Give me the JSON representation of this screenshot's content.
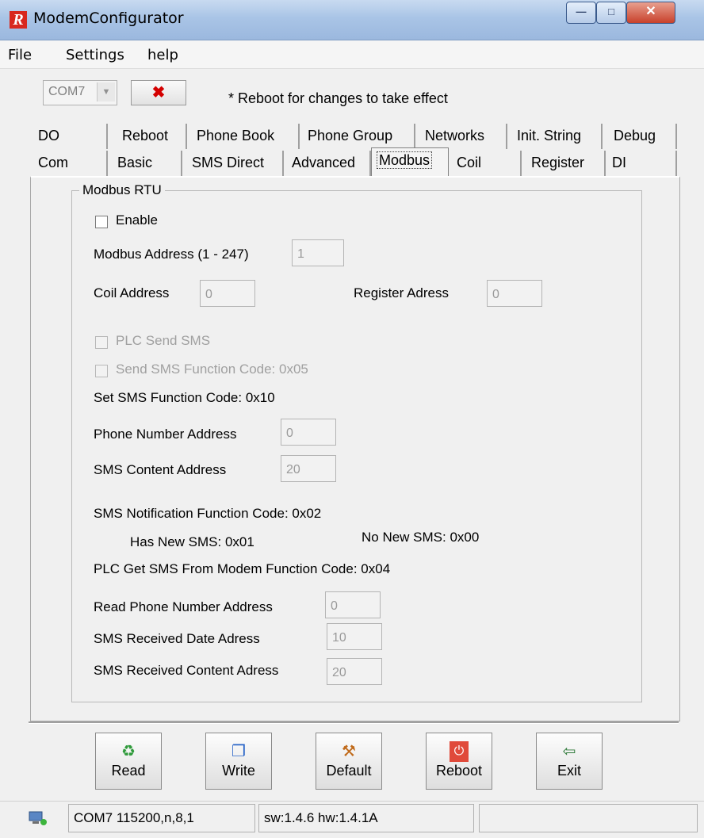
{
  "window": {
    "title": "ModemConfigurator",
    "controls": {
      "minimize": "—",
      "maximize": "□",
      "close": "✕"
    }
  },
  "menu": {
    "items": [
      "File",
      "Settings",
      "help"
    ]
  },
  "toolbar": {
    "port": "COM7",
    "disconnect_glyph": "✖",
    "note": "* Reboot for changes to take effect"
  },
  "tabs": {
    "row1": [
      "DO",
      "Reboot",
      "Phone Book",
      "Phone Group",
      "Networks",
      "Init. String",
      "Debug"
    ],
    "row2": [
      "Com",
      "Basic",
      "SMS Direct",
      "Advanced",
      "Modbus",
      "Coil",
      "Register",
      "DI"
    ],
    "active": "Modbus"
  },
  "modbus": {
    "group_title": "Modbus RTU",
    "enable_label": "Enable",
    "address_label": "Modbus Address (1 - 247)",
    "address_value": "1",
    "coil_label": "Coil Address",
    "coil_value": "0",
    "register_label": "Register Adress",
    "register_value": "0",
    "plc_send_label": "PLC Send SMS",
    "send_fc_label": "Send SMS Function Code: 0x05",
    "set_fc_label": "Set SMS Function Code: 0x10",
    "phone_addr_label": "Phone Number Address",
    "phone_addr_value": "0",
    "content_addr_label": "SMS Content Address",
    "content_addr_value": "20",
    "notif_label": "SMS Notification Function Code: 0x02",
    "has_new_label": "Has New SMS: 0x01",
    "no_new_label": "No New SMS: 0x00",
    "plc_get_label": "PLC Get SMS From Modem Function Code: 0x04",
    "read_phone_label": "Read Phone Number Address",
    "read_phone_value": "0",
    "recv_date_label": "SMS Received Date Adress",
    "recv_date_value": "10",
    "recv_content_label": "SMS Received Content Adress",
    "recv_content_value": "20"
  },
  "actions": {
    "read": "Read",
    "write": "Write",
    "default": "Default",
    "reboot": "Reboot",
    "exit": "Exit"
  },
  "status": {
    "port_info": "COM7 115200,n,8,1",
    "version": "sw:1.4.6 hw:1.4.1A"
  }
}
